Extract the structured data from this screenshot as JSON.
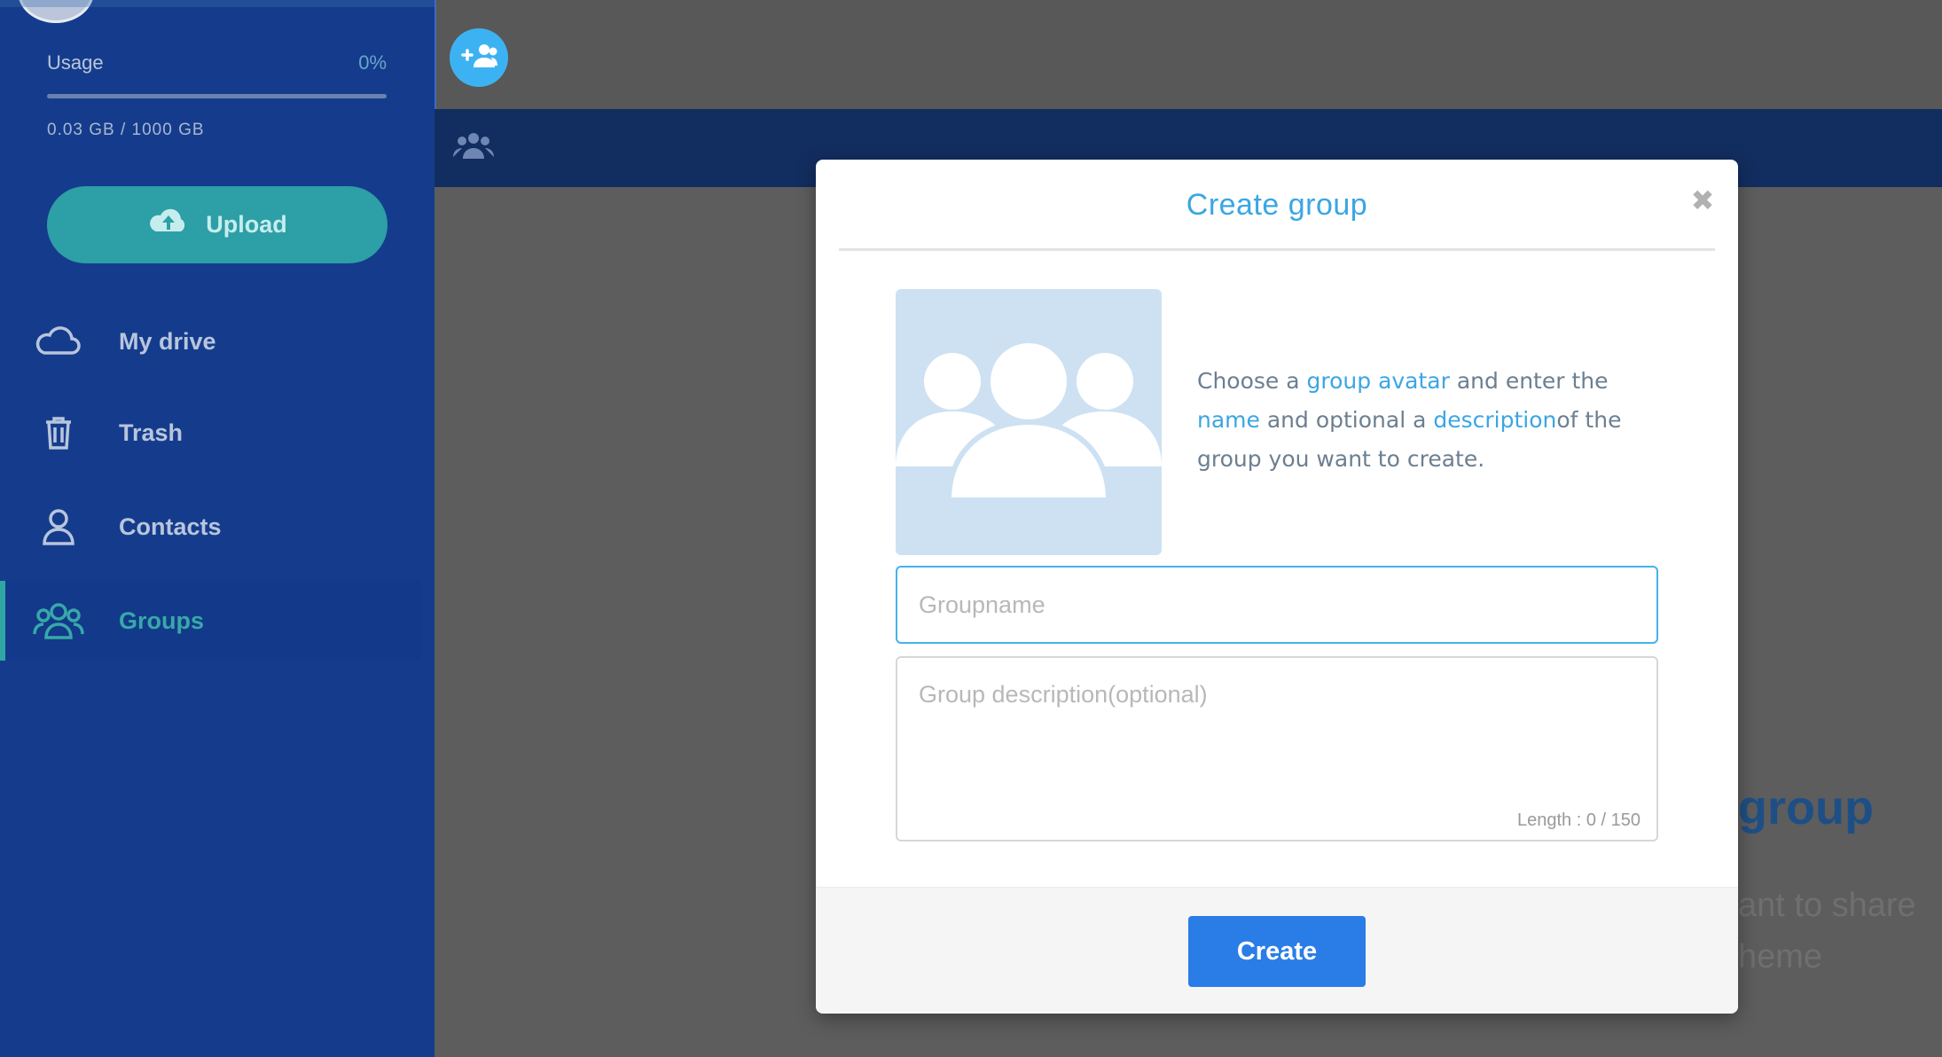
{
  "sidebar": {
    "usage_label": "Usage",
    "usage_percent": "0%",
    "usage_fraction": 0.0,
    "usage_amount": "0.03 GB / 1000 GB",
    "upload_label": "Upload",
    "items": [
      {
        "label": "My drive",
        "icon": "cloud-icon"
      },
      {
        "label": "Trash",
        "icon": "trash-icon"
      },
      {
        "label": "Contacts",
        "icon": "user-icon"
      },
      {
        "label": "Groups",
        "icon": "group-icon",
        "active": true
      }
    ]
  },
  "header": {
    "add_group_icon": "add-group-icon",
    "section_icon": "group-icon"
  },
  "background": {
    "heading_fragment": "group",
    "text_line1_fragment": "ant to share",
    "text_line2_fragment": "heme"
  },
  "modal": {
    "title": "Create group",
    "close_icon": "close-icon",
    "intro": {
      "part1": "Choose a ",
      "hl1": "group avatar",
      "part2": " and enter the ",
      "hl2": "name",
      "part3": " and optional a ",
      "hl3": "description",
      "part4": "of the group you want to create."
    },
    "groupname_placeholder": "Groupname",
    "groupname_value": "",
    "description_placeholder": "Group description(optional)",
    "description_value": "",
    "length_counter": "Length : 0 / 150",
    "create_label": "Create"
  },
  "colors": {
    "accent": "#3aa6e4",
    "primary_button": "#2a7de6",
    "sidebar": "#153c8c",
    "active_teal": "#2fa6a2"
  }
}
